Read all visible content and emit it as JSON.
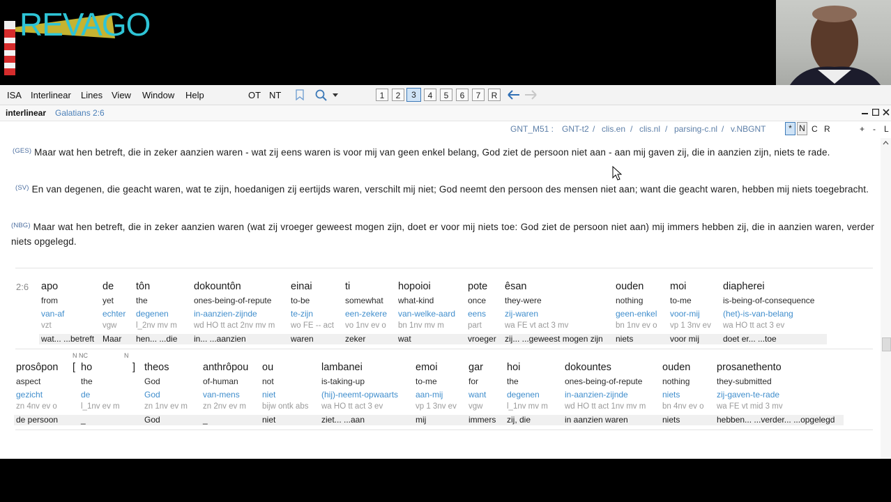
{
  "logo": {
    "text": "REVAGO"
  },
  "menu": {
    "items": [
      "ISA",
      "Interlinear",
      "Lines",
      "View",
      "Window",
      "Help"
    ],
    "ot": "OT",
    "nt": "NT",
    "pages": [
      "1",
      "2",
      "3",
      "4",
      "5",
      "6",
      "7",
      "R"
    ],
    "active_page": "3"
  },
  "panel": {
    "title": "interlinear",
    "reference": "Galatians 2:6"
  },
  "sources": {
    "items": [
      "GNT_M51 :",
      "GNT-t2",
      "/",
      "clis.en",
      "/",
      "clis.nl",
      "/",
      "parsing-c.nl",
      "/",
      "v.NBGNT"
    ],
    "toggles": [
      "*",
      "N",
      "C",
      "R"
    ],
    "zoom": [
      "+",
      "-",
      "L"
    ]
  },
  "verses": [
    {
      "tag": "(GES)",
      "text": "Maar wat hen betreft, die in zeker aanzien waren - wat zij eens waren is voor mij van geen enkel belang, God ziet de persoon niet aan - aan mij gaven zij, die in aanzien zijn, niets te rade."
    },
    {
      "tag": "(SV)",
      "text": "En van degenen, die geacht waren, wat te zijn, hoedanigen zij eertijds waren, verschilt mij niet; God neemt den persoon des mensen niet aan; want die geacht waren, hebben mij niets toegebracht."
    },
    {
      "tag": "(NBG)",
      "text": "Maar wat hen betreft, die in zeker aanzien waren (wat zij vroeger geweest mogen zijn, doet er voor mij niets toe: God ziet de persoon niet aan) mij immers hebben zij, die in aanzien waren, verder niets opgelegd."
    }
  ],
  "verse_ref": "2:6",
  "row1": [
    {
      "gk": "apo",
      "en": "from",
      "nl": "van-af",
      "ps": "vzt",
      "tr": "wat... ...betreft"
    },
    {
      "gk": "de",
      "en": "yet",
      "nl": "echter",
      "ps": "vgw",
      "tr": "Maar"
    },
    {
      "gk": "tôn",
      "en": "the",
      "nl": "degenen",
      "ps": "l_2nv mv m",
      "tr": "hen... ...die"
    },
    {
      "gk": "dokountôn",
      "en": "ones-being-of-repute",
      "nl": "in-aanzien-zijnde",
      "ps": "wd HO tt act 2nv mv m",
      "tr": "in... ...aanzien"
    },
    {
      "gk": "einai",
      "en": "to-be",
      "nl": "te-zijn",
      "ps": "wo FE -- act",
      "tr": "waren"
    },
    {
      "gk": "ti",
      "en": "somewhat",
      "nl": "een-zekere",
      "ps": "vo 1nv ev o",
      "tr": "zeker"
    },
    {
      "gk": "hopoioi",
      "en": "what-kind",
      "nl": "van-welke-aard",
      "ps": "bn 1nv mv m",
      "tr": "wat"
    },
    {
      "gk": "pote",
      "en": "once",
      "nl": "eens",
      "ps": "part",
      "tr": "vroeger"
    },
    {
      "gk": "êsan",
      "en": "they-were",
      "nl": "zij-waren",
      "ps": "wa FE vt act 3 mv",
      "tr": "zij... ...geweest mogen zijn"
    },
    {
      "gk": "ouden",
      "en": "nothing",
      "nl": "geen-enkel",
      "ps": "bn 1nv ev o",
      "tr": "niets"
    },
    {
      "gk": "moi",
      "en": "to-me",
      "nl": "voor-mij",
      "ps": "vp 1 3nv ev",
      "tr": "voor mij"
    },
    {
      "gk": "diapherei",
      "en": "is-being-of-consequence",
      "nl": "(het)-is-van-belang",
      "ps": "wa HO tt act 3 ev",
      "tr": "doet er... ...toe"
    }
  ],
  "row2": [
    {
      "gk": "prosôpon",
      "en": "aspect",
      "nl": "gezicht",
      "ps": "zn 4nv ev o",
      "tr": "de persoon"
    },
    {
      "gk": "[",
      "en": "",
      "nl": "",
      "ps": "",
      "tr": ""
    },
    {
      "gk": "ho",
      "en": "the",
      "nl": "de",
      "ps": "l_1nv ev m",
      "tr": "_",
      "note": "N NC"
    },
    {
      "gk": "]",
      "en": "",
      "nl": "",
      "ps": "",
      "tr": "",
      "note": "N"
    },
    {
      "gk": "theos",
      "en": "God",
      "nl": "God",
      "ps": "zn 1nv ev m",
      "tr": "God"
    },
    {
      "gk": "anthrôpou",
      "en": "of-human",
      "nl": "van-mens",
      "ps": "zn 2nv ev m",
      "tr": "_"
    },
    {
      "gk": "ou",
      "en": "not",
      "nl": "niet",
      "ps": "bijw ontk abs",
      "tr": "niet"
    },
    {
      "gk": "lambanei",
      "en": "is-taking-up",
      "nl": "(hij)-neemt-opwaarts",
      "ps": "wa HO tt act 3 ev",
      "tr": "ziet... ...aan"
    },
    {
      "gk": "emoi",
      "en": "to-me",
      "nl": "aan-mij",
      "ps": "vp 1 3nv ev",
      "tr": "mij"
    },
    {
      "gk": "gar",
      "en": "for",
      "nl": "want",
      "ps": "vgw",
      "tr": "immers"
    },
    {
      "gk": "hoi",
      "en": "the",
      "nl": "degenen",
      "ps": "l_1nv mv m",
      "tr": "zij, die"
    },
    {
      "gk": "dokountes",
      "en": "ones-being-of-repute",
      "nl": "in-aanzien-zijnde",
      "ps": "wd HO tt act 1nv mv m",
      "tr": "in aanzien waren"
    },
    {
      "gk": "ouden",
      "en": "nothing",
      "nl": "niets",
      "ps": "bn 4nv ev o",
      "tr": "niets"
    },
    {
      "gk": "prosanethento",
      "en": "they-submitted",
      "nl": "zij-gaven-te-rade",
      "ps": "wa FE vt mid 3 mv",
      "tr": "hebben... ...verder... ...opgelegd"
    }
  ]
}
